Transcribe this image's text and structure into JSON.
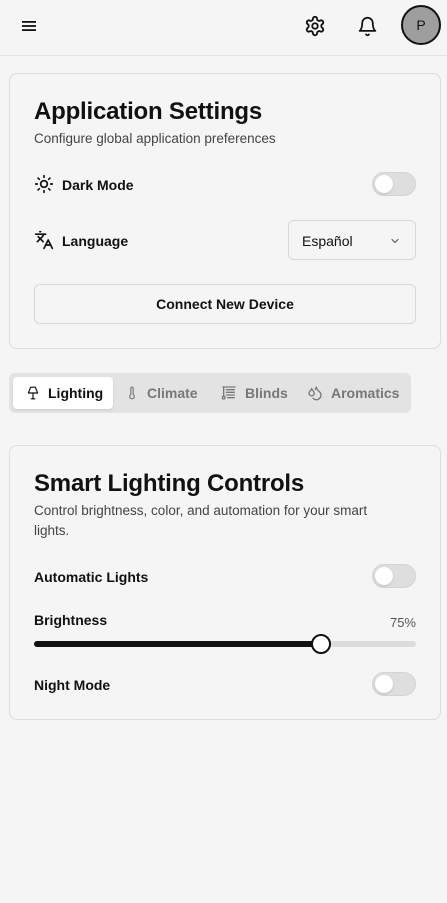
{
  "topbar": {
    "menu_icon": "hamburger-menu-icon",
    "settings_icon": "gear-icon",
    "notifications_icon": "bell-icon",
    "avatar_initial": "P"
  },
  "app_settings": {
    "title": "Application Settings",
    "subtitle": "Configure global application preferences",
    "dark_mode": {
      "label": "Dark Mode",
      "icon": "sun-icon",
      "enabled": false
    },
    "language": {
      "label": "Language",
      "icon": "translate-icon",
      "value": "Español"
    },
    "connect_button": "Connect New Device"
  },
  "tabs": [
    {
      "label": "Lighting",
      "icon": "lamp-icon",
      "active": true
    },
    {
      "label": "Climate",
      "icon": "thermometer-icon",
      "active": false
    },
    {
      "label": "Blinds",
      "icon": "blinds-icon",
      "active": false
    },
    {
      "label": "Aromatics",
      "icon": "droplets-icon",
      "active": false
    }
  ],
  "lighting": {
    "title": "Smart Lighting Controls",
    "subtitle": "Control brightness, color, and automation for your smart lights.",
    "automatic_lights": {
      "label": "Automatic Lights",
      "enabled": false
    },
    "brightness": {
      "label": "Brightness",
      "value": 75,
      "display": "75%"
    },
    "night_mode": {
      "label": "Night Mode",
      "enabled": false
    }
  },
  "colors": {
    "background": "#f5f5f5",
    "text": "#111111",
    "muted": "#777777",
    "border": "#dcdcdc",
    "avatar": "#9e9e9e"
  }
}
